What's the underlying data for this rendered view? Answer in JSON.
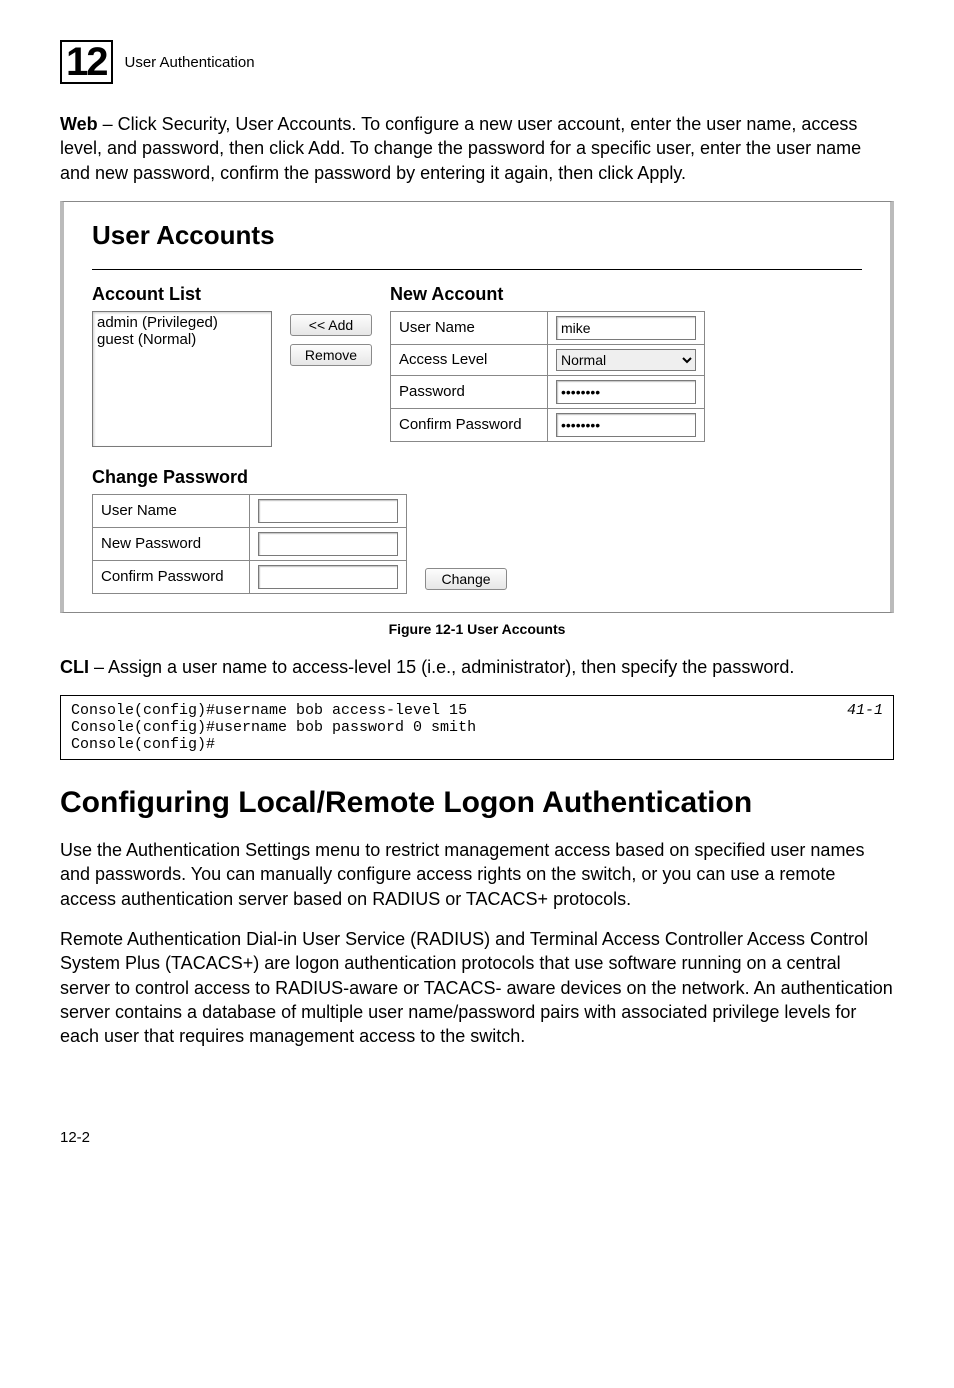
{
  "header": {
    "chapter_number": "12",
    "chapter_title": "User Authentication"
  },
  "intro": {
    "lead_bold": "Web",
    "text": " – Click Security, User Accounts. To configure a new user account, enter the user name, access level, and password, then click Add. To change the password for a specific user, enter the user name and new password, confirm the password by entering it again, then click Apply."
  },
  "panel": {
    "title": "User Accounts",
    "account_list": {
      "heading": "Account List",
      "items": [
        "admin (Privileged)",
        "guest (Normal)"
      ]
    },
    "buttons": {
      "add": "<< Add",
      "remove": "Remove"
    },
    "new_account": {
      "heading": "New Account",
      "rows": {
        "user_name_label": "User Name",
        "user_name_value": "mike",
        "access_level_label": "Access Level",
        "access_level_value": "Normal",
        "password_label": "Password",
        "password_value": "********",
        "confirm_label": "Confirm Password",
        "confirm_value": "********"
      }
    },
    "change_password": {
      "heading": "Change Password",
      "user_name_label": "User Name",
      "new_password_label": "New Password",
      "confirm_password_label": "Confirm Password",
      "change_btn": "Change"
    }
  },
  "figure_caption": "Figure 12-1  User Accounts",
  "cli": {
    "lead_bold": "CLI",
    "text": " – Assign a user name to access-level 15 (i.e., administrator), then specify the password."
  },
  "code": {
    "lines": "Console(config)#username bob access-level 15\nConsole(config)#username bob password 0 smith\nConsole(config)#",
    "ref": "41-1"
  },
  "section_heading": "Configuring Local/Remote Logon Authentication",
  "para1": "Use the Authentication Settings menu to restrict management access based on specified user names and passwords. You can manually configure access rights on the switch, or you can use a remote access authentication server based on RADIUS or TACACS+ protocols.",
  "para2": "Remote Authentication Dial-in User Service (RADIUS) and Terminal Access Controller Access Control System Plus (TACACS+) are logon authentication protocols that use software running on a central server to control access to RADIUS-aware or TACACS- aware devices on the network. An authentication server contains a database of multiple user name/password pairs with associated privilege levels for each user that requires management access to the switch.",
  "footer": "12-2"
}
